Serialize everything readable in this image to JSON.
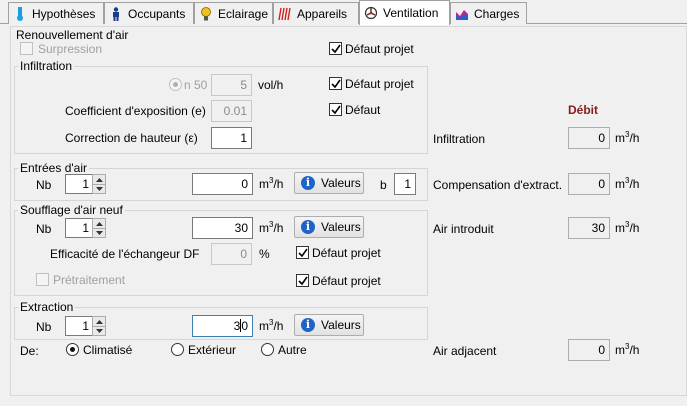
{
  "tabs": [
    {
      "label": "Hypothèses",
      "icon": "thermometer-icon"
    },
    {
      "label": "Occupants",
      "icon": "person-icon"
    },
    {
      "label": "Eclairage",
      "icon": "lightbulb-icon"
    },
    {
      "label": "Appareils",
      "icon": "radiator-icon"
    },
    {
      "label": "Ventilation",
      "icon": "fan-icon",
      "active": true
    },
    {
      "label": "Charges",
      "icon": "chart-icon"
    }
  ],
  "renouvellement": {
    "title": "Renouvellement d'air",
    "suppression_label": "Surpression",
    "defaut_projet_label": "Défaut projet"
  },
  "infiltration": {
    "title": "Infiltration",
    "n50_label": "n 50",
    "n50_value": "5",
    "n50_unit": "vol/h",
    "defaut_projet_label": "Défaut projet",
    "coef_label": "Coefficient d'exposition (e)",
    "coef_value": "0.01",
    "defaut_label": "Défaut",
    "correction_label": "Correction de hauteur (ε)",
    "correction_value": "1"
  },
  "entrees": {
    "title": "Entrées d'air",
    "nb_label": "Nb",
    "nb_value": "1",
    "flow_value": "0",
    "unit_m": "m",
    "unit_3": "3",
    "unit_h": "/h",
    "valeurs_label": "Valeurs",
    "b_label": "b",
    "b_value": "1"
  },
  "soufflage": {
    "title": "Soufflage d'air neuf",
    "nb_label": "Nb",
    "nb_value": "1",
    "flow_value": "30",
    "valeurs_label": "Valeurs",
    "efficacite_label": "Efficacité de l'échangeur DF",
    "efficacite_value": "0",
    "percent_label": "%",
    "defaut_projet_label": "Défaut projet",
    "pretraitement_label": "Prétraitement",
    "defaut_projet2_label": "Défaut projet"
  },
  "extraction": {
    "title": "Extraction",
    "nb_label": "Nb",
    "nb_value": "1",
    "flow_value_left": "3",
    "flow_value_right": "0",
    "valeurs_label": "Valeurs",
    "de_label": "De:",
    "radio_climatise": "Climatisé",
    "radio_exterieur": "Extérieur",
    "radio_autre": "Autre"
  },
  "debit": {
    "title": "Débit",
    "infiltration_label": "Infiltration",
    "infiltration_value": "0",
    "compensation_label": "Compensation d'extract.",
    "compensation_value": "0",
    "air_introduit_label": "Air introduit",
    "air_introduit_value": "30",
    "air_adjacent_label": "Air adjacent",
    "air_adjacent_value": "0"
  },
  "colors": {
    "debit_title": "#8b1a1a",
    "info_icon": "#1e64c8"
  }
}
